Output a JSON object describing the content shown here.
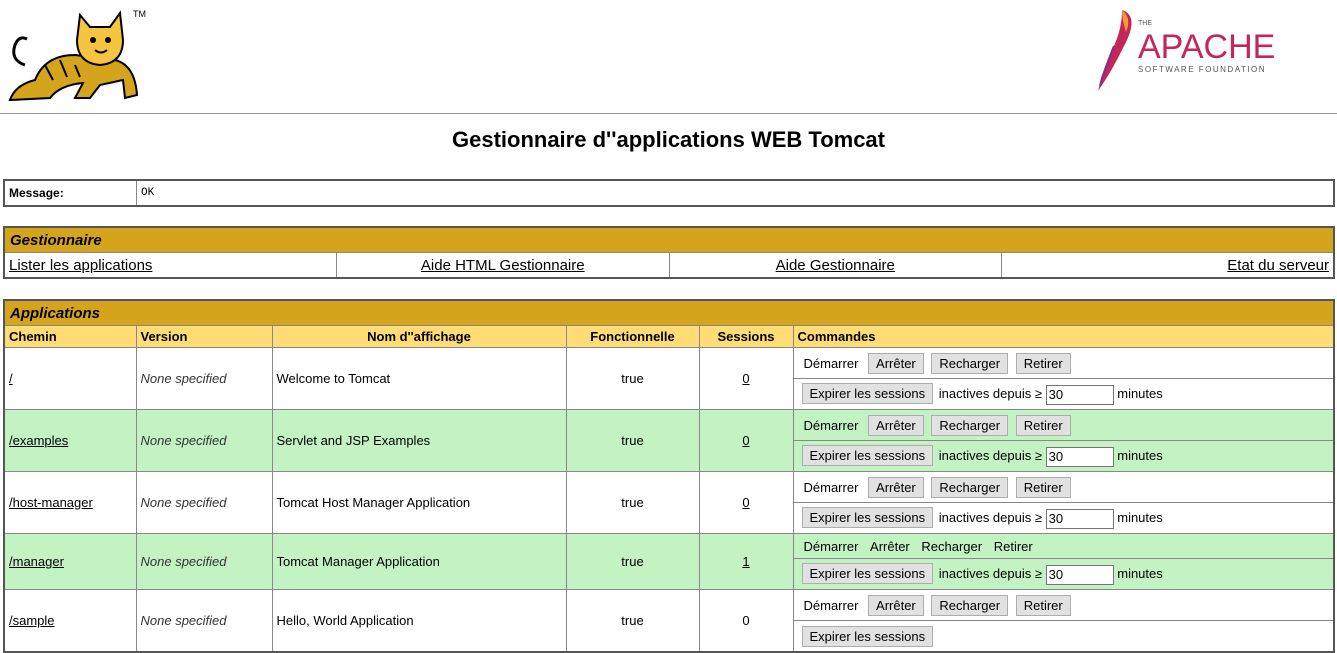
{
  "header": {
    "tomcat_tm": "TM",
    "apache": {
      "the": "THE",
      "name": "APACHE",
      "subtitle": "SOFTWARE FOUNDATION"
    }
  },
  "page_title": "Gestionnaire d''applications WEB Tomcat",
  "message": {
    "label": "Message:",
    "value": "OK"
  },
  "manager": {
    "title": "Gestionnaire",
    "links": [
      "Lister les applications",
      "Aide HTML Gestionnaire",
      "Aide Gestionnaire",
      "Etat du serveur"
    ]
  },
  "applications": {
    "title": "Applications",
    "columns": [
      "Chemin",
      "Version",
      "Nom d''affichage",
      "Fonctionnelle",
      "Sessions",
      "Commandes"
    ],
    "commands": {
      "start": "Démarrer",
      "stop": "Arrêter",
      "reload": "Recharger",
      "undeploy": "Retirer",
      "expire": "Expirer les sessions",
      "idle_label": "inactives depuis ≥",
      "minutes": "minutes"
    },
    "rows": [
      {
        "path": "/",
        "version": "None specified",
        "name": "Welcome to Tomcat",
        "running": "true",
        "sessions": "0",
        "idle": "30"
      },
      {
        "path": "/examples",
        "version": "None specified",
        "name": "Servlet and JSP Examples",
        "running": "true",
        "sessions": "0",
        "idle": "30"
      },
      {
        "path": "/host-manager",
        "version": "None specified",
        "name": "Tomcat Host Manager Application",
        "running": "true",
        "sessions": "0",
        "idle": "30"
      },
      {
        "path": "/manager",
        "version": "None specified",
        "name": "Tomcat Manager Application",
        "running": "true",
        "sessions": "1",
        "idle": "30"
      },
      {
        "path": "/sample",
        "version": "None specified",
        "name": "Hello, World Application",
        "running": "true",
        "sessions": "0",
        "idle": ""
      }
    ]
  },
  "colors": {
    "section": "#d4a51c",
    "header_row": "#ffdc75",
    "alt_row": "#c3f3c3"
  }
}
